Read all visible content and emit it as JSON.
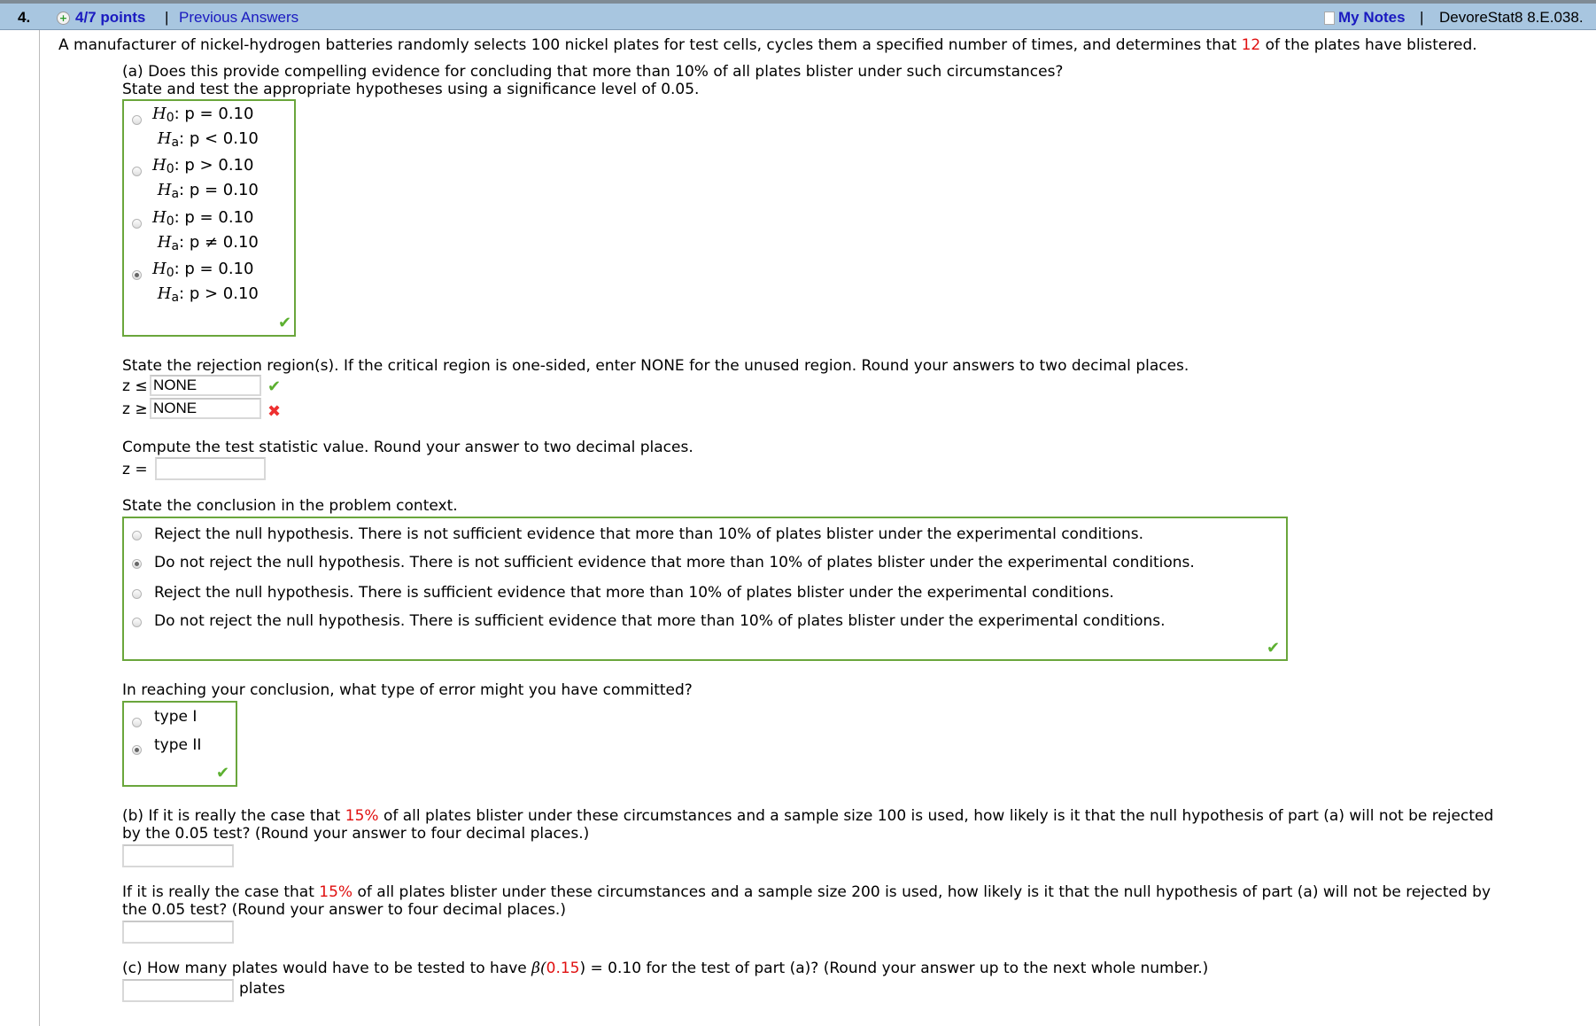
{
  "header": {
    "question_number": "4.",
    "points": "4/7 points",
    "separator": "|",
    "previous_answers": "Previous Answers",
    "my_notes": "My Notes",
    "problem_code": "DevoreStat8 8.E.038."
  },
  "intro": {
    "before": "A manufacturer of nickel-hydrogen batteries randomly selects 100 nickel plates for test cells, cycles them a specified number of times, and determines that ",
    "highlight": "12",
    "after": " of the plates have blistered."
  },
  "part_a": {
    "question_line1": "(a) Does this provide compelling evidence for concluding that more than 10% of all plates blister under such circumstances?",
    "question_line2": "State and test the appropriate hypotheses using a significance level of 0.05.",
    "hypotheses": [
      {
        "h0": ": p = 0.10",
        "ha": ": p < 0.10",
        "selected": false
      },
      {
        "h0": ": p > 0.10",
        "ha": ": p = 0.10",
        "selected": false
      },
      {
        "h0": ": p = 0.10",
        "ha": ": p ≠ 0.10",
        "selected": false
      },
      {
        "h0": ": p = 0.10",
        "ha": ": p > 0.10",
        "selected": true
      }
    ],
    "h0_label": "H",
    "h0_sub": "0",
    "ha_label": "H",
    "ha_sub": "a",
    "hypotheses_status": "correct",
    "rejection_prompt": "State the rejection region(s). If the critical region is one-sided, enter NONE for the unused region. Round your answers to two decimal places.",
    "rejection_lower_label": "z ≤",
    "rejection_lower_value": "NONE",
    "rejection_lower_status": "correct",
    "rejection_upper_label": "z ≥",
    "rejection_upper_value": "NONE",
    "rejection_upper_status": "incorrect",
    "statistic_prompt": "Compute the test statistic value. Round your answer to two decimal places.",
    "statistic_label": "z =",
    "statistic_value": "",
    "conclusion_prompt": "State the conclusion in the problem context.",
    "conclusions": [
      {
        "text": "Reject the null hypothesis. There is not sufficient evidence that more than 10% of plates blister under the experimental conditions.",
        "selected": false
      },
      {
        "text": "Do not reject the null hypothesis. There is not sufficient evidence that more than 10% of plates blister under the experimental conditions.",
        "selected": true
      },
      {
        "text": "Reject the null hypothesis. There is sufficient evidence that more than 10% of plates blister under the experimental conditions.",
        "selected": false
      },
      {
        "text": "Do not reject the null hypothesis. There is sufficient evidence that more than 10% of plates blister under the experimental conditions.",
        "selected": false
      }
    ],
    "conclusion_status": "correct",
    "error_prompt": "In reaching your conclusion, what type of error might you have committed?",
    "error_options": [
      {
        "text": "type I",
        "selected": false
      },
      {
        "text": "type II",
        "selected": true
      }
    ],
    "error_status": "correct"
  },
  "part_b": {
    "q1_before": "(b) If it is really the case that ",
    "q1_highlight": "15%",
    "q1_after": " of all plates blister under these circumstances and a sample size 100 is used, how likely is it that the null hypothesis of part (a) will not be rejected",
    "q1_line2": "by the 0.05 test? (Round your answer to four decimal places.)",
    "q1_value": "",
    "q2_before": "If it is really the case that ",
    "q2_highlight": "15%",
    "q2_after": " of all plates blister under these circumstances and a sample size 200 is used, how likely is it that the null hypothesis of part (a) will not be rejected by",
    "q2_line2": "the 0.05 test? (Round your answer to four decimal places.)",
    "q2_value": ""
  },
  "part_c": {
    "before": "(c) How many plates would have to be tested to have ",
    "beta": "β(",
    "highlight": "0.15",
    "after": ") = 0.10 for the test of part (a)? (Round your answer up to the next whole number.)",
    "value": "",
    "unit": "plates"
  },
  "icons": {
    "check": "✔",
    "cross": "✖",
    "plus": "+"
  },
  "colors": {
    "header_bg": "#a8c6e0",
    "link": "#1a1ac0",
    "highlight": "#e01010",
    "correct_border": "#6aa63c",
    "check": "#5cb030",
    "cross": "#ee3030"
  }
}
